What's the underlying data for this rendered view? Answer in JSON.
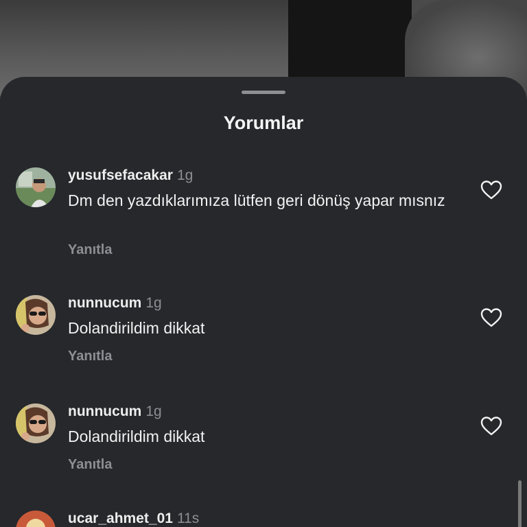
{
  "sheet": {
    "title": "Yorumlar"
  },
  "comments": [
    {
      "username": "yusufsefacakar",
      "time": "1g",
      "text": "Dm den yazdıklarımıza lütfen geri dönüş yapar mısnız",
      "reply_label": "Yanıtla"
    },
    {
      "username": "nunnucum",
      "time": "1g",
      "text": "Dolandirildim dikkat",
      "reply_label": "Yanıtla"
    },
    {
      "username": "nunnucum",
      "time": "1g",
      "text": "Dolandirildim dikkat",
      "reply_label": "Yanıtla"
    },
    {
      "username": "ucar_ahmet_01",
      "time": "11s"
    }
  ],
  "icons": {
    "like": "heart-outline-icon"
  },
  "colors": {
    "sheet_bg": "#26282c",
    "secondary_text": "#8e8e93",
    "primary_text": "#f2f2f2"
  }
}
